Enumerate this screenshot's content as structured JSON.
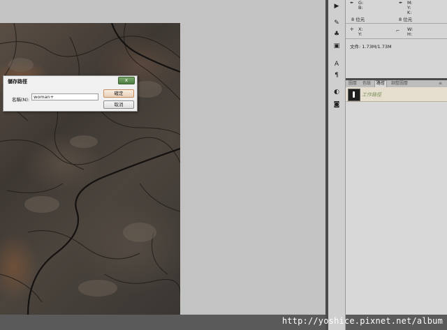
{
  "dialog": {
    "title": "儲存路徑",
    "close_label": "x",
    "name_label": "名稱(N):",
    "name_value": "woman+",
    "ok_label": "確定",
    "cancel_label": "取消"
  },
  "info_panel": {
    "g_label": "G:",
    "b_label": "B:",
    "m_label": "M:",
    "y_label": "Y:",
    "k_label": "K:",
    "bit_left": "8 位元",
    "bit_right": "8 位元",
    "x_label": "X:",
    "y2_label": "Y:",
    "w_label": "W:",
    "h_label": "H:",
    "file_info": "文件: 1.73M/1.73M"
  },
  "panel_tabs": [
    "圖層",
    "色版",
    "路徑",
    "調整圖層"
  ],
  "paths": [
    {
      "name": "工作路徑"
    }
  ],
  "watermark": "http://yoshice.pixnet.net/album",
  "colors": {
    "workspace": "#c3c3c3",
    "dialog_ok_border": "#c68d5e",
    "path_row_bg": "#e6dfcf"
  }
}
